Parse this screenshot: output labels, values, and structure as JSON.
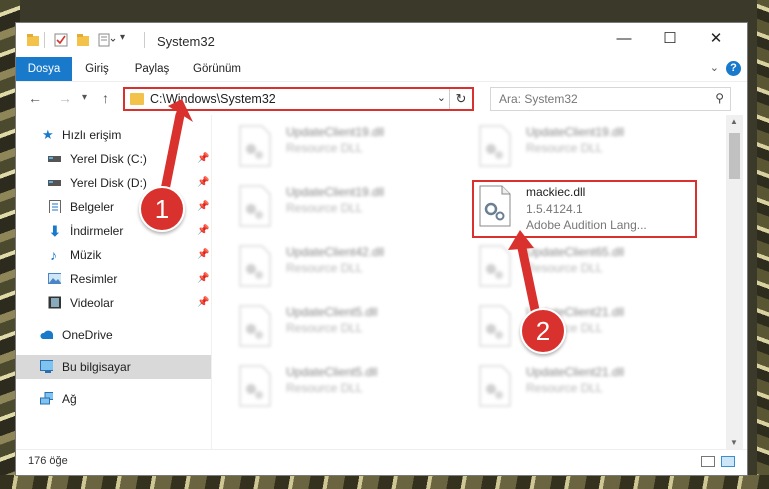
{
  "window": {
    "title": "System32",
    "controls": {
      "minimize": "—",
      "maximize": "☐",
      "close": "✕"
    }
  },
  "ribbon": {
    "tabs": [
      {
        "label": "Dosya",
        "active": true
      },
      {
        "label": "Giriş"
      },
      {
        "label": "Paylaş"
      },
      {
        "label": "Görünüm"
      }
    ],
    "help_icon": "?"
  },
  "nav": {
    "address": "C:\\Windows\\System32",
    "search_placeholder": "Ara: System32"
  },
  "sidebar": {
    "items": [
      {
        "label": "Hızlı erişim",
        "icon": "star-icon",
        "pinned": false
      },
      {
        "label": "Yerel Disk (C:)",
        "icon": "drive-icon",
        "pinned": true
      },
      {
        "label": "Yerel Disk (D:)",
        "icon": "drive-icon",
        "pinned": true
      },
      {
        "label": "Belgeler",
        "icon": "documents-icon",
        "pinned": true
      },
      {
        "label": "İndirmeler",
        "icon": "download-icon",
        "pinned": true
      },
      {
        "label": "Müzik",
        "icon": "music-icon",
        "pinned": true
      },
      {
        "label": "Resimler",
        "icon": "pictures-icon",
        "pinned": true
      },
      {
        "label": "Videolar",
        "icon": "videos-icon",
        "pinned": true
      },
      {
        "label": "OneDrive",
        "icon": "onedrive-icon",
        "pinned": false
      },
      {
        "label": "Bu bilgisayar",
        "icon": "computer-icon",
        "pinned": false,
        "selected": true
      },
      {
        "label": "Ağ",
        "icon": "network-icon",
        "pinned": false
      }
    ]
  },
  "files": {
    "left": [
      {
        "name": "UpdateClient19.dll",
        "desc": "Resource DLL"
      },
      {
        "name": "UpdateClient19.dll",
        "desc": "Resource DLL"
      },
      {
        "name": "UpdateClient42.dll",
        "desc": "Resource DLL"
      },
      {
        "name": "UpdateClient5.dll",
        "desc": "Resource DLL"
      },
      {
        "name": "UpdateClient5.dll",
        "desc": "Resource DLL"
      }
    ],
    "right": [
      {
        "name": "UpdateClient19.dll",
        "desc": "Resource DLL"
      },
      {
        "name": "mackiec.dll",
        "version": "1.5.4124.1",
        "desc": "Adobe Audition Lang..."
      },
      {
        "name": "UpdateClient65.dll",
        "desc": "Resource DLL"
      },
      {
        "name": "UpdateClient21.dll",
        "desc": "Resource DLL"
      },
      {
        "name": "UpdateClient21.dll",
        "desc": "Resource DLL"
      }
    ]
  },
  "status": {
    "count": "176 öğe"
  },
  "annotations": {
    "step1": "1",
    "step2": "2",
    "color": "#d9322e"
  }
}
